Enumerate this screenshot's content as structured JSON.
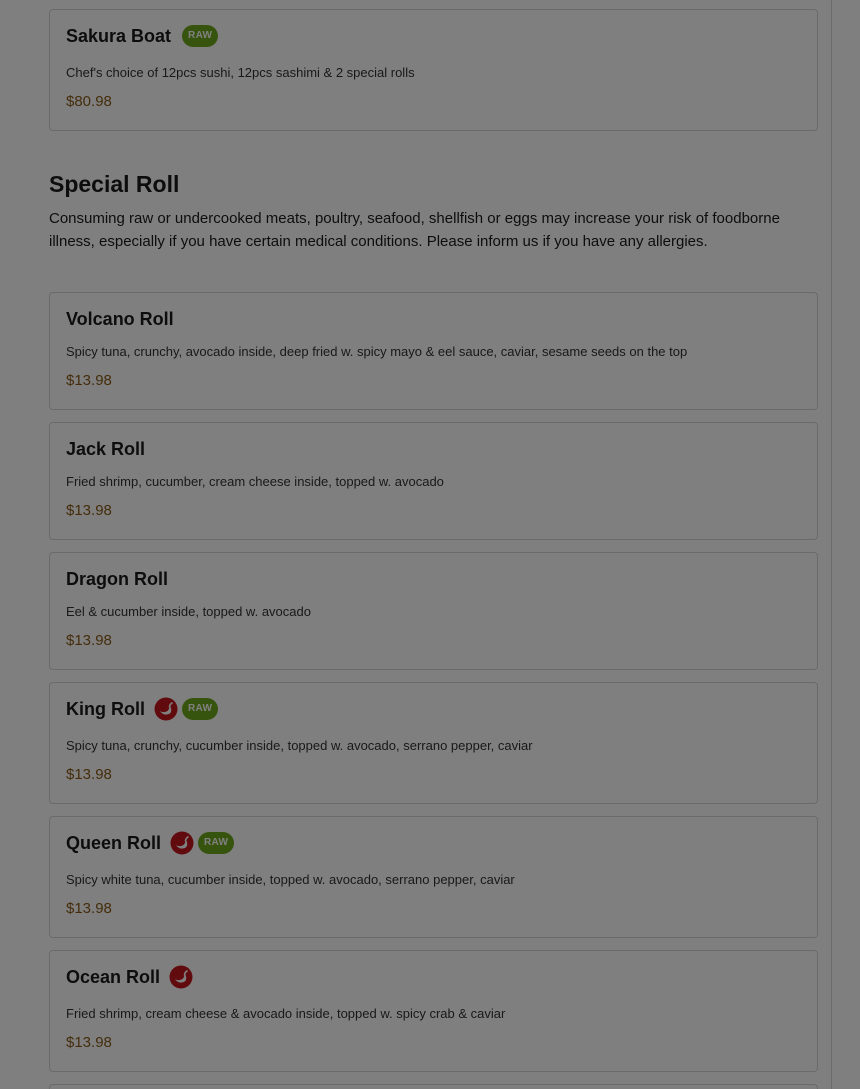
{
  "colors": {
    "raw_badge_bg": "#6fa81c",
    "spicy_icon": "#c4161c",
    "price": "#8a5a17",
    "overlay": "rgba(0,0,0,0.5)"
  },
  "previous_item": {
    "name": "Sakura Boat",
    "badges": [
      "raw"
    ],
    "raw_label": "RAW",
    "description": "Chef's choice of 12pcs sushi, 12pcs sashimi & 2 special rolls",
    "price": "$80.98"
  },
  "section": {
    "title": "Special Roll",
    "note": "Consuming raw or undercooked meats, poultry, seafood, shellfish or eggs may increase your risk of foodborne illness, especially if you have certain medical conditions. Please inform us if you have any allergies."
  },
  "items": [
    {
      "name": "Volcano Roll",
      "description": "Spicy tuna, crunchy, avocado inside, deep fried w. spicy mayo & eel sauce, caviar, sesame seeds on the top",
      "price": "$13.98"
    },
    {
      "name": "Jack Roll",
      "description": "Fried shrimp, cucumber, cream cheese inside, topped w. avocado",
      "price": "$13.98"
    },
    {
      "name": "Dragon Roll",
      "description": "Eel & cucumber inside, topped w. avocado",
      "price": "$13.98"
    },
    {
      "name": "King Roll",
      "icons": [
        "spicy-icon"
      ],
      "raw_label": "RAW",
      "description": "Spicy tuna, crunchy, cucumber inside, topped w. avocado, serrano pepper, caviar",
      "price": "$13.98"
    },
    {
      "name": "Queen Roll",
      "icons": [
        "spicy-icon"
      ],
      "raw_label": "RAW",
      "description": "Spicy white tuna, cucumber inside, topped w. avocado, serrano pepper, caviar",
      "price": "$13.98"
    },
    {
      "name": "Ocean Roll",
      "icons": [
        "spicy-icon"
      ],
      "description": "Fried shrimp, cream cheese & avocado inside, topped w. spicy crab & caviar",
      "price": "$13.98"
    }
  ]
}
